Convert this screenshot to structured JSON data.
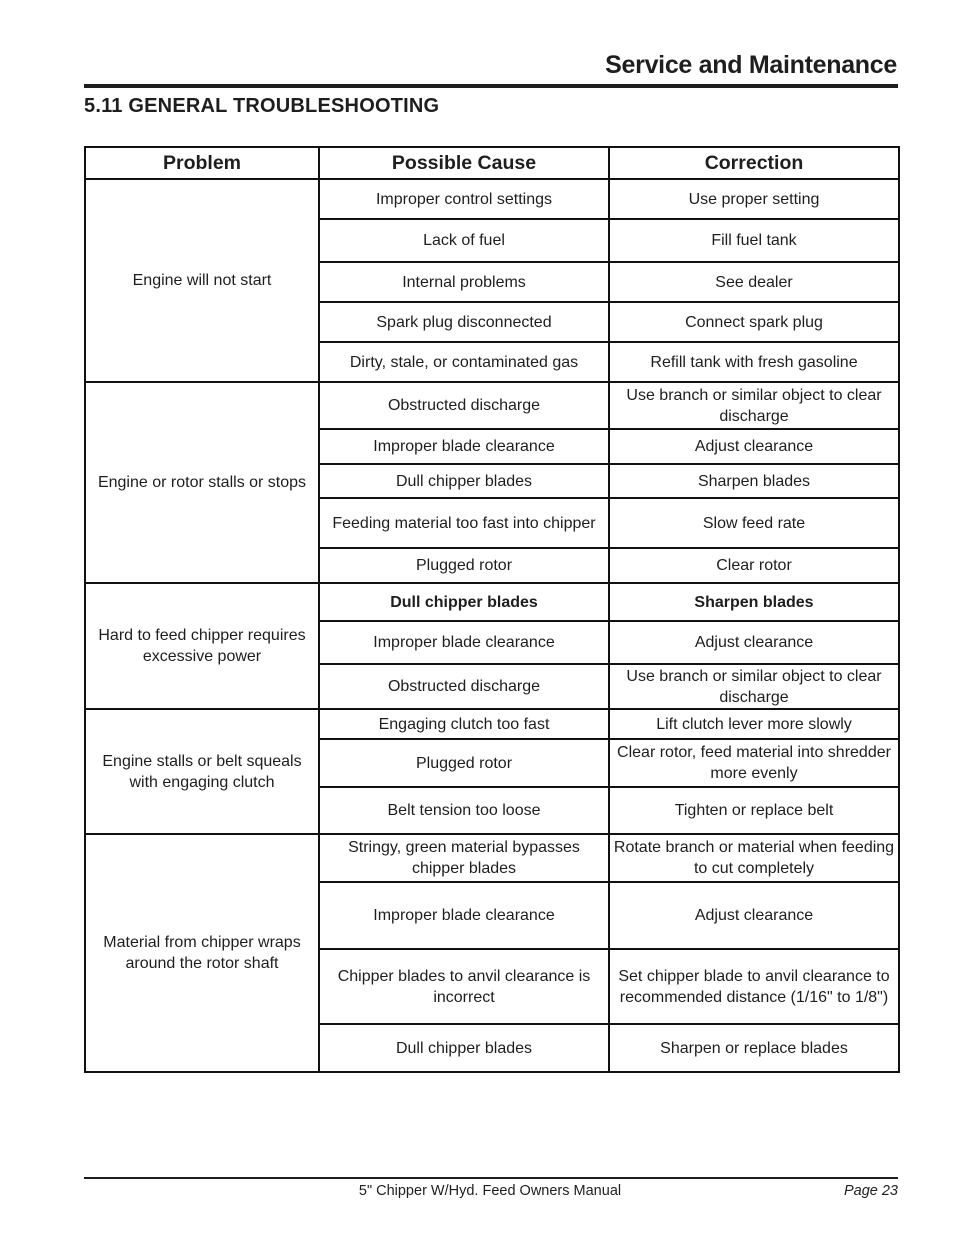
{
  "header": {
    "title": "Service and Maintenance"
  },
  "section": {
    "title": "5.11  GENERAL  TROUBLESHOOTING"
  },
  "table": {
    "columns": [
      "Problem",
      "Possible Cause",
      "Correction"
    ],
    "groups": [
      {
        "problem": "Engine will not start",
        "rows": [
          {
            "cause": "Improper control settings",
            "correction": "Use proper setting"
          },
          {
            "cause": "Lack of fuel",
            "correction": "Fill fuel tank"
          },
          {
            "cause": "Internal problems",
            "correction": "See dealer"
          },
          {
            "cause": "Spark plug disconnected",
            "correction": "Connect spark plug"
          },
          {
            "cause": "Dirty, stale, or contaminated gas",
            "correction": "Refill tank with fresh gasoline"
          }
        ]
      },
      {
        "problem": "Engine or rotor stalls or stops",
        "rows": [
          {
            "cause": "Obstructed discharge",
            "correction": "Use branch or similar object to clear discharge"
          },
          {
            "cause": "Improper blade clearance",
            "correction": "Adjust clearance"
          },
          {
            "cause": "Dull chipper blades",
            "correction": "Sharpen blades"
          },
          {
            "cause": "Feeding material too fast into chipper",
            "correction": "Slow feed rate"
          },
          {
            "cause": "Plugged rotor",
            "correction": "Clear rotor"
          }
        ]
      },
      {
        "problem": "Hard to feed chipper requires excessive power",
        "rows": [
          {
            "cause": "Dull chipper blades",
            "correction": "Sharpen blades",
            "bold": true
          },
          {
            "cause": "Improper blade clearance",
            "correction": "Adjust clearance"
          },
          {
            "cause": "Obstructed discharge",
            "correction": "Use branch or similar object to clear discharge"
          }
        ]
      },
      {
        "problem": "Engine stalls or belt squeals with engaging clutch",
        "rows": [
          {
            "cause": "Engaging clutch too fast",
            "correction": "Lift clutch lever more slowly"
          },
          {
            "cause": "Plugged rotor",
            "correction": "Clear rotor, feed material into shredder more evenly"
          },
          {
            "cause": "Belt tension too loose",
            "correction": "Tighten or replace belt"
          }
        ]
      },
      {
        "problem": "Material from chipper wraps around the rotor shaft",
        "rows": [
          {
            "cause": "Stringy, green material bypasses chipper blades",
            "correction": "Rotate branch or material when feeding to cut completely"
          },
          {
            "cause": "Improper blade clearance",
            "correction": "Adjust clearance"
          },
          {
            "cause": "Chipper blades to anvil clearance is incorrect",
            "correction": "Set chipper blade to anvil clearance to recommended distance (1/16\" to 1/8\")"
          },
          {
            "cause": "Dull chipper blades",
            "correction": "Sharpen or replace blades"
          }
        ]
      }
    ]
  },
  "footer": {
    "manual_title": "5\" Chipper W/Hyd. Feed Owners Manual",
    "page_label": "Page 23"
  }
}
